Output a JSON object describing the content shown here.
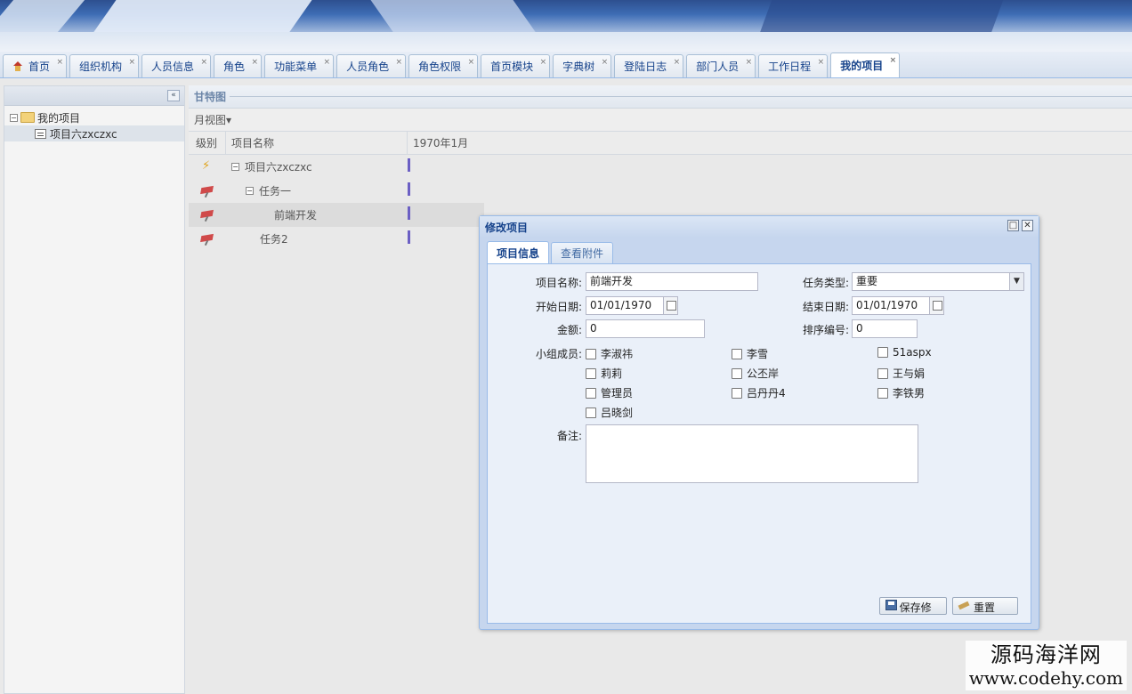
{
  "tabs": [
    {
      "label": "首页",
      "active": false
    },
    {
      "label": "组织机构",
      "active": false
    },
    {
      "label": "人员信息",
      "active": false
    },
    {
      "label": "角色",
      "active": false
    },
    {
      "label": "功能菜单",
      "active": false
    },
    {
      "label": "人员角色",
      "active": false
    },
    {
      "label": "角色权限",
      "active": false
    },
    {
      "label": "首页模块",
      "active": false
    },
    {
      "label": "字典树",
      "active": false
    },
    {
      "label": "登陆日志",
      "active": false
    },
    {
      "label": "部门人员",
      "active": false
    },
    {
      "label": "工作日程",
      "active": false
    },
    {
      "label": "我的项目",
      "active": true
    }
  ],
  "tab_close_glyph": "×",
  "tree": {
    "root": "我的项目",
    "child": "项目六zxczxc",
    "toggle_glyph": "−",
    "collapse_glyph": "«"
  },
  "gantt": {
    "title": "甘特图",
    "view_menu": "月视图▾",
    "columns": {
      "level": "级别",
      "name": "项目名称",
      "time": "1970年1月"
    },
    "rows": [
      {
        "icon": "bolt-icon",
        "name": "项目六zxczxc",
        "toggle": "−"
      },
      {
        "icon": "pin-icon",
        "name": "任务一",
        "toggle": "−"
      },
      {
        "icon": "pin-icon",
        "name": "前端开发",
        "toggle": ""
      },
      {
        "icon": "pin-icon",
        "name": "任务2",
        "toggle": ""
      }
    ]
  },
  "dialog": {
    "title": "修改项目",
    "max_glyph": "□",
    "close_glyph": "✕",
    "tabs": [
      "项目信息",
      "查看附件"
    ],
    "form": {
      "name_label": "项目名称:",
      "name_value": "前端开发",
      "type_label": "任务类型:",
      "type_value": "重要",
      "type_glyph": "▼",
      "start_label": "开始日期:",
      "start_value": "01/01/1970",
      "end_label": "结束日期:",
      "end_value": "01/01/1970",
      "amount_label": "金额:",
      "amount_value": "0",
      "order_label": "排序编号:",
      "order_value": "0",
      "members_label": "小组成员:",
      "members": [
        "李淑祎",
        "李雪",
        "51aspx",
        "莉莉",
        "公丕岸",
        "王与娟",
        "管理员",
        "吕丹丹4",
        "李铁男",
        "吕晓剑"
      ],
      "remark_label": "备注:"
    },
    "buttons": {
      "save": "保存修改",
      "reset": "重置"
    }
  },
  "watermark": {
    "line1": "源码海洋网",
    "line2": "www.codehy.com"
  }
}
